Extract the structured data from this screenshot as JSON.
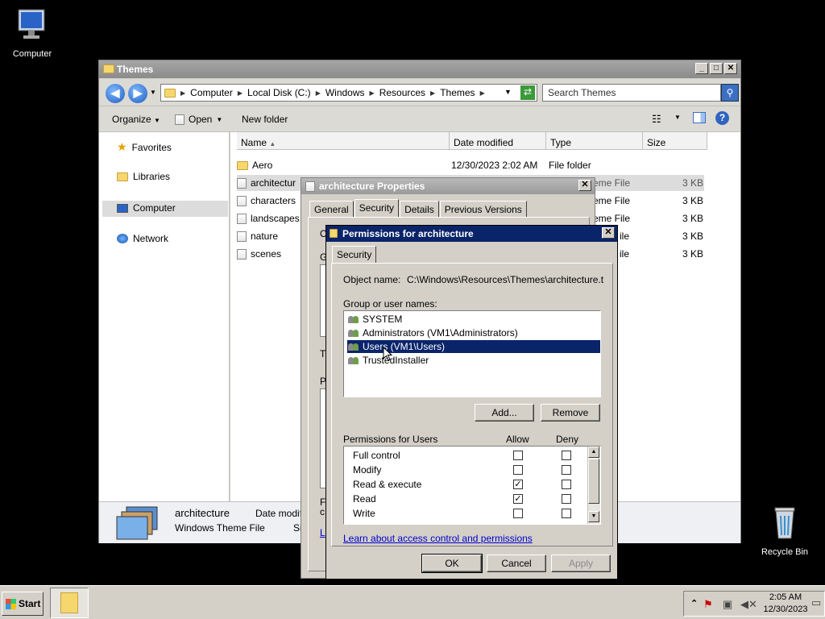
{
  "desktop": {
    "computer_label": "Computer",
    "recycle_label": "Recycle Bin"
  },
  "explorer": {
    "title": "Themes",
    "breadcrumbs": [
      "Computer",
      "Local Disk (C:)",
      "Windows",
      "Resources",
      "Themes"
    ],
    "search_placeholder": "Search Themes",
    "toolbar": {
      "organize": "Organize",
      "open": "Open",
      "new_folder": "New folder"
    },
    "nav": {
      "favorites": "Favorites",
      "libraries": "Libraries",
      "computer": "Computer",
      "network": "Network"
    },
    "columns": {
      "name": "Name",
      "date": "Date modified",
      "type": "Type",
      "size": "Size"
    },
    "files": [
      {
        "name": "Aero",
        "date": "12/30/2023 2:02 AM",
        "type": "File folder",
        "size": ""
      },
      {
        "name": "architectur",
        "date": "",
        "type": "eme File",
        "size": "3 KB"
      },
      {
        "name": "characters",
        "date": "",
        "type": "eme File",
        "size": "3 KB"
      },
      {
        "name": "landscapes",
        "date": "",
        "type": "eme File",
        "size": "3 KB"
      },
      {
        "name": "nature",
        "date": "",
        "type": "ile",
        "size": "3 KB"
      },
      {
        "name": "scenes",
        "date": "",
        "type": "ile",
        "size": "3 KB"
      }
    ],
    "details": {
      "name": "architecture",
      "kind": "Windows Theme File",
      "date_label": "Date modifi",
      "size_label": "Siz"
    }
  },
  "props": {
    "title": "architecture Properties",
    "tabs": [
      "General",
      "Security",
      "Details",
      "Previous Versions"
    ],
    "partial_labels": {
      "o": "O",
      "g": "G",
      "t": "T",
      "p": "P",
      "f": "F",
      "c": "c",
      "l": "L"
    }
  },
  "perm": {
    "title": "Permissions for architecture",
    "tab": "Security",
    "object_label": "Object name:",
    "object_value": "C:\\Windows\\Resources\\Themes\\architecture.ther",
    "group_label": "Group or user names:",
    "users": [
      "SYSTEM",
      "Administrators (VM1\\Administrators)",
      "Users (VM1\\Users)",
      "TrustedInstaller"
    ],
    "add_button": "Add...",
    "remove_button": "Remove",
    "perm_label": "Permissions for Users",
    "allow_label": "Allow",
    "deny_label": "Deny",
    "permissions": [
      {
        "name": "Full control",
        "allow": false,
        "deny": false
      },
      {
        "name": "Modify",
        "allow": false,
        "deny": false
      },
      {
        "name": "Read & execute",
        "allow": true,
        "deny": false
      },
      {
        "name": "Read",
        "allow": true,
        "deny": false
      },
      {
        "name": "Write",
        "allow": false,
        "deny": false
      }
    ],
    "link": "Learn about access control and permissions",
    "ok": "OK",
    "cancel": "Cancel",
    "apply": "Apply"
  },
  "taskbar": {
    "start": "Start",
    "time": "2:05 AM",
    "date": "12/30/2023"
  }
}
